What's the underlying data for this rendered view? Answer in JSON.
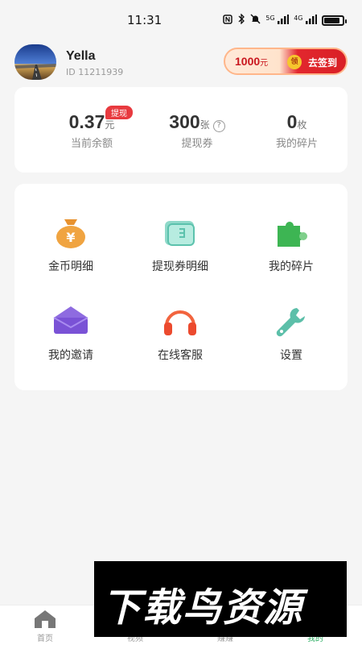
{
  "status_bar": {
    "time": "11:31",
    "icons": [
      "nfc-icon",
      "bluetooth-icon",
      "mute-icon",
      "5g-signal-icon",
      "4g-signal-icon",
      "battery-icon"
    ],
    "net1": "5G",
    "net2": "4G"
  },
  "profile": {
    "name": "Yella",
    "id_text": "ID  11211939",
    "signin": {
      "amount": "1000",
      "unit": "元",
      "coin_label": "领",
      "label": "去签到"
    }
  },
  "balance": {
    "withdraw_badge": "提现",
    "items": [
      {
        "value": "0.37",
        "unit": "元",
        "label": "当前余额"
      },
      {
        "value": "300",
        "unit": "张",
        "label": "提现券"
      },
      {
        "value": "0",
        "unit": "枚",
        "label": "我的碎片"
      }
    ]
  },
  "menu": {
    "items": [
      {
        "label": "金币明细",
        "icon": "money-bag-icon"
      },
      {
        "label": "提现券明细",
        "icon": "ticket-icon"
      },
      {
        "label": "我的碎片",
        "icon": "puzzle-icon"
      },
      {
        "label": "我的邀请",
        "icon": "envelope-icon"
      },
      {
        "label": "在线客服",
        "icon": "headphones-icon"
      },
      {
        "label": "设置",
        "icon": "wrench-icon"
      }
    ]
  },
  "bottom_nav": {
    "items": [
      {
        "label": "首页",
        "icon": "home-icon"
      },
      {
        "label": "视频",
        "icon": "video-icon"
      },
      {
        "label": "赚赚",
        "icon": "earn-icon"
      },
      {
        "label": "我的",
        "icon": "profile-icon"
      }
    ],
    "active_color": "#2cae63"
  },
  "watermark": {
    "text": "下载鸟资源"
  },
  "colors": {
    "accent_red": "#e83a3f",
    "accent_green": "#2cae63",
    "background": "#f5f5f5"
  }
}
